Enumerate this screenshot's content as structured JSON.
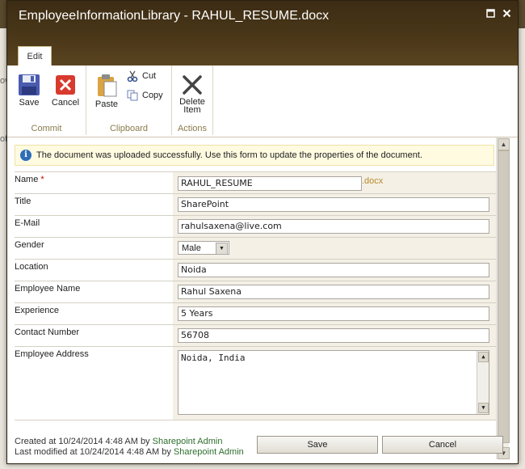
{
  "window": {
    "title": "EmployeeInformationLibrary - RAHUL_RESUME.docx"
  },
  "ribbon": {
    "tab_label": "Edit",
    "commit": {
      "group_label": "Commit",
      "save_label": "Save",
      "cancel_label": "Cancel"
    },
    "clipboard": {
      "group_label": "Clipboard",
      "paste_label": "Paste",
      "cut_label": "Cut",
      "copy_label": "Copy"
    },
    "actions": {
      "group_label": "Actions",
      "delete_label_1": "Delete",
      "delete_label_2": "Item"
    }
  },
  "message": "The document was uploaded successfully. Use this form to update the properties of the document.",
  "form": {
    "name": {
      "label": "Name",
      "required_marker": "*",
      "value": "RAHUL_RESUME",
      "extension": ".docx"
    },
    "title": {
      "label": "Title",
      "value": "SharePoint"
    },
    "email": {
      "label": "E-Mail",
      "value": "rahulsaxena@live.com"
    },
    "gender": {
      "label": "Gender",
      "value": "Male"
    },
    "location": {
      "label": "Location",
      "value": "Noida"
    },
    "employee_name": {
      "label": "Employee Name",
      "value": "Rahul Saxena"
    },
    "experience": {
      "label": "Experience",
      "value": "5 Years"
    },
    "contact_number": {
      "label": "Contact Number",
      "value": "56708"
    },
    "employee_address": {
      "label": "Employee Address",
      "value": "Noida, India"
    }
  },
  "footer": {
    "created_prefix": "Created at 10/24/2014 4:48 AM by ",
    "created_by": "Sharepoint Admin",
    "modified_prefix": "Last modified at 10/24/2014 4:48 AM by ",
    "modified_by": "Sharepoint Admin",
    "save_label": "Save",
    "cancel_label": "Cancel"
  },
  "background": {
    "left_char_1": "ov",
    "left_char_2": "of"
  },
  "colors": {
    "titlebar": "#4b3819",
    "accent_group_label": "#8a7a4a",
    "info_icon": "#2e6db8",
    "required": "#cc0000",
    "link": "#2d6f2d"
  }
}
